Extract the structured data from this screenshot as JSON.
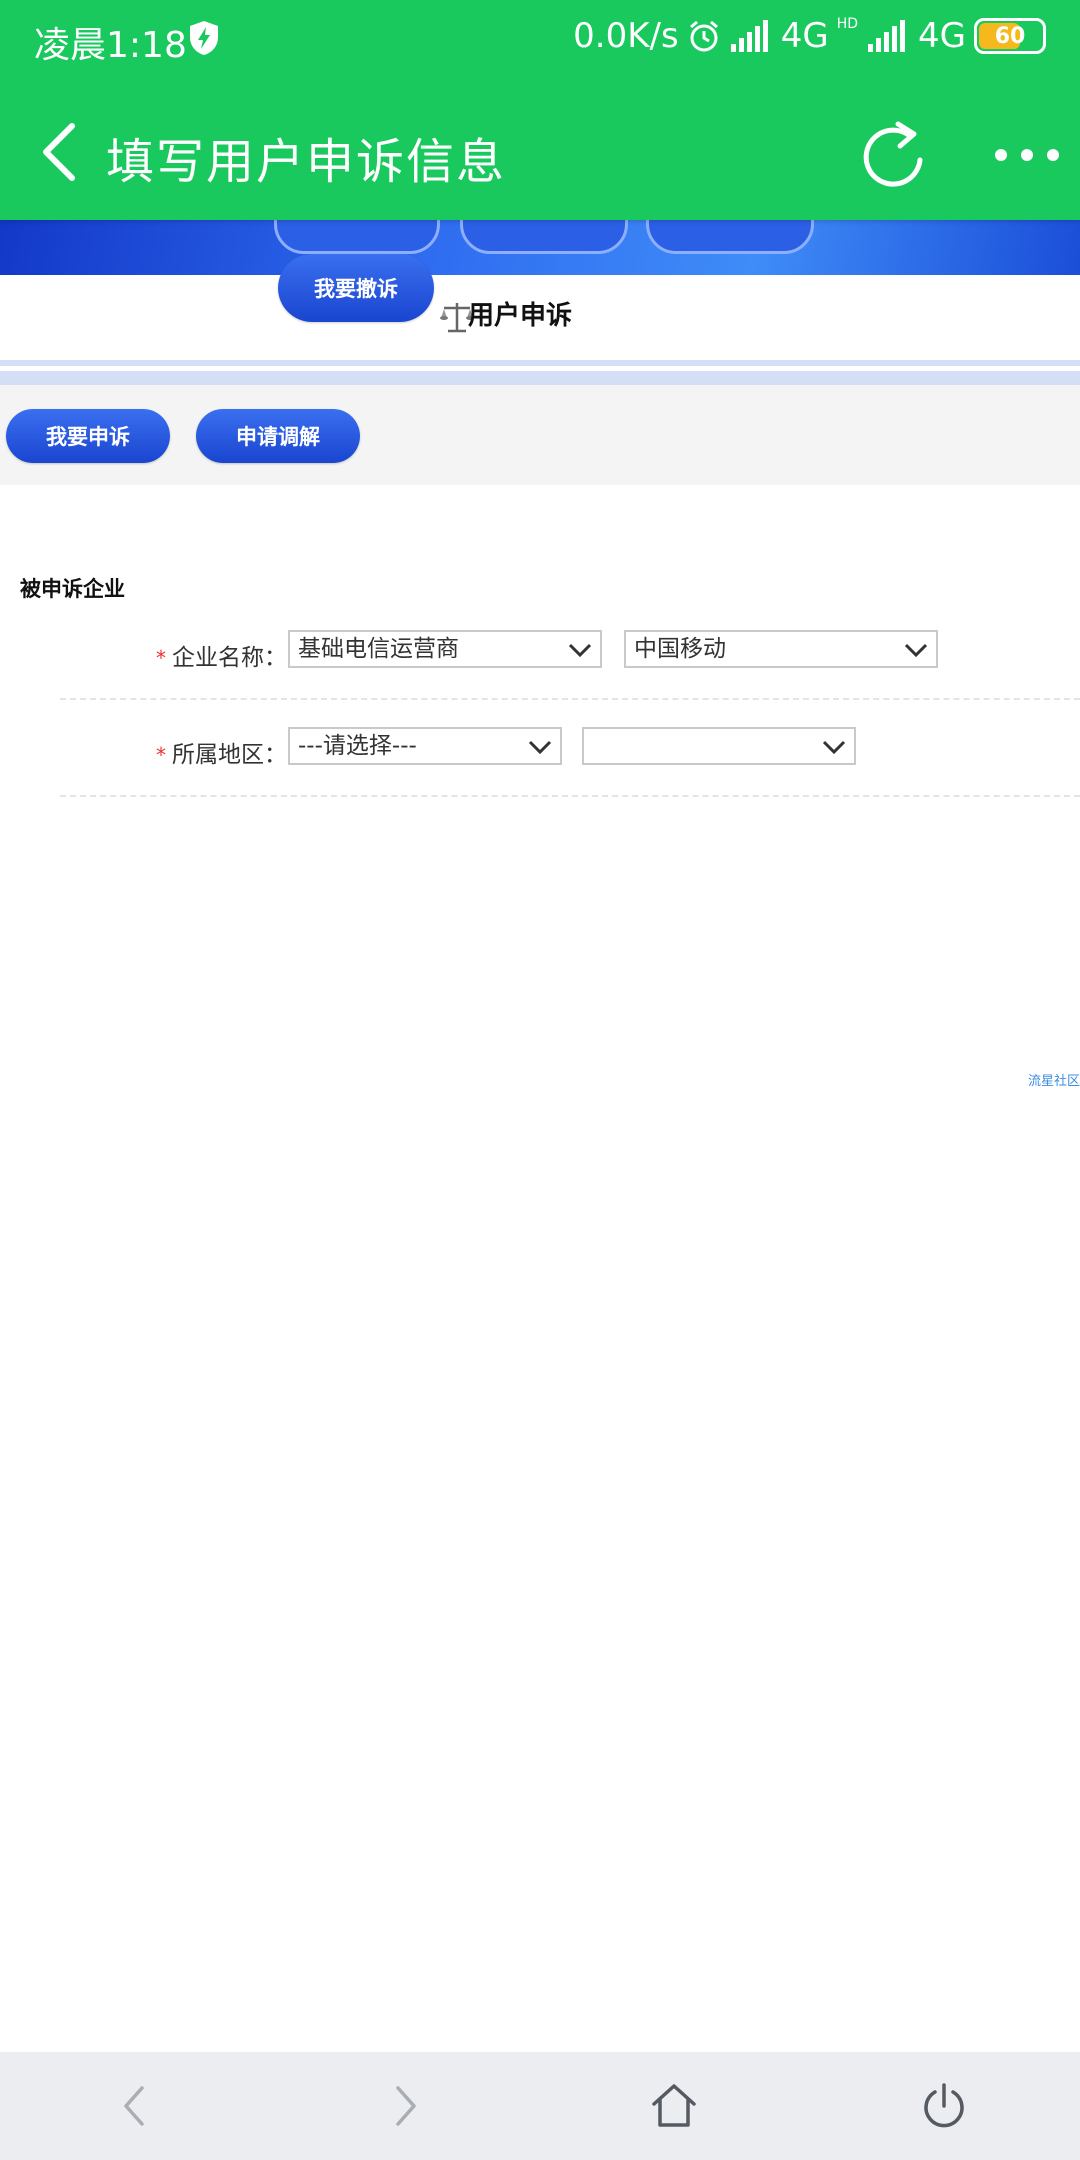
{
  "status_bar": {
    "time": "凌晨1:18",
    "net_speed": "0.0K/s",
    "net1": "4G",
    "net2": "4G",
    "hd": "HD",
    "battery": "60",
    "battery_color": "#f5b81d"
  },
  "app_bar": {
    "title": "填写用户申诉信息",
    "background": "#19c95e"
  },
  "site_nav": {
    "withdraw_label": "我要撤诉",
    "tab_title": "用户申诉"
  },
  "actions": {
    "complain_label": "我要申诉",
    "mediation_label": "申请调解"
  },
  "form": {
    "section_title": "被申诉企业",
    "company": {
      "required_mark": "*",
      "label": "企业名称：",
      "type_value": "基础电信运营商",
      "name_value": "中国移动"
    },
    "region": {
      "required_mark": "*",
      "label": "所属地区：",
      "province_value": "---请选择---",
      "city_value": ""
    }
  },
  "footer": {
    "link_text": "流星社区"
  },
  "icons": {
    "shield": "shield-lightning-icon",
    "alarm": "alarm-clock-icon",
    "back": "chevron-left-icon",
    "refresh": "refresh-icon",
    "more": "more-dots-icon",
    "scale": "balance-scale-icon",
    "nav_back": "arrow-left-icon",
    "nav_forward": "arrow-right-icon",
    "home": "home-icon",
    "power": "power-icon"
  },
  "colors": {
    "primary_blue": "#2557e0",
    "required_red": "#e33333",
    "link_blue": "#3b8de0"
  }
}
